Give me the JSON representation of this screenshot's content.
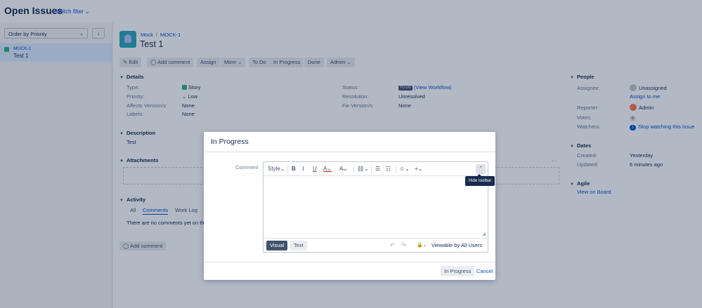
{
  "header": {
    "title": "Open Issues",
    "switch_filter": "Switch filter"
  },
  "sidebar": {
    "order_by": "Order by Priority",
    "sort_icon": "arrow-down-icon",
    "issue": {
      "key": "MOCK-1",
      "summary": "Test 1"
    }
  },
  "issue": {
    "breadcrumb": {
      "project": "Mock",
      "key": "MOCK-1"
    },
    "title": "Test 1",
    "toolbar": {
      "edit": "Edit",
      "add_comment": "Add comment",
      "assign": "Assign",
      "more": "More",
      "to_do": "To Do",
      "in_progress": "In Progress",
      "done": "Done",
      "admin": "Admin"
    },
    "details": {
      "heading": "Details",
      "type_label": "Type:",
      "type_value": "Story",
      "priority_label": "Priority:",
      "priority_value": "Low",
      "affects_label": "Affects Version/s:",
      "affects_value": "None",
      "labels_label": "Labels:",
      "labels_value": "None",
      "status_label": "Status:",
      "status_badge": "TO DO",
      "status_link": "(View Workflow)",
      "resolution_label": "Resolution:",
      "resolution_value": "Unresolved",
      "fix_label": "Fix Version/s:",
      "fix_value": "None"
    },
    "description": {
      "heading": "Description",
      "text": "Test"
    },
    "attachments": {
      "heading": "Attachments",
      "more": "···"
    },
    "activity": {
      "heading": "Activity",
      "tabs": [
        "All",
        "Comments",
        "Work Log"
      ],
      "empty": "There are no comments yet on this",
      "add_comment": "Add comment"
    },
    "people": {
      "heading": "People",
      "assignee_label": "Assignee:",
      "assignee_value": "Unassigned",
      "assign_to_me": "Assign to me",
      "reporter_label": "Reporter:",
      "reporter_value": "Admin",
      "votes_label": "Votes:",
      "votes_value": "0",
      "watchers_label": "Watchers:",
      "watchers_count": "1",
      "watchers_link": "Stop watching this issue"
    },
    "dates": {
      "heading": "Dates",
      "created_label": "Created:",
      "created_value": "Yesterday",
      "updated_label": "Updated:",
      "updated_value": "6 minutes ago"
    },
    "agile": {
      "heading": "Agile",
      "link": "View on Board"
    }
  },
  "dialog": {
    "title": "In Progress",
    "comment_label": "Comment",
    "toolbar": {
      "style": "Style",
      "hide_toolbar_tooltip": "Hide toolbar"
    },
    "footer": {
      "visual": "Visual",
      "text": "Text",
      "viewable": "Viewable by All Users"
    },
    "submit": "In Progress",
    "cancel": "Cancel"
  },
  "colors": {
    "accent": "#0052cc",
    "story": "#36b37e",
    "text": "#172b4d"
  }
}
